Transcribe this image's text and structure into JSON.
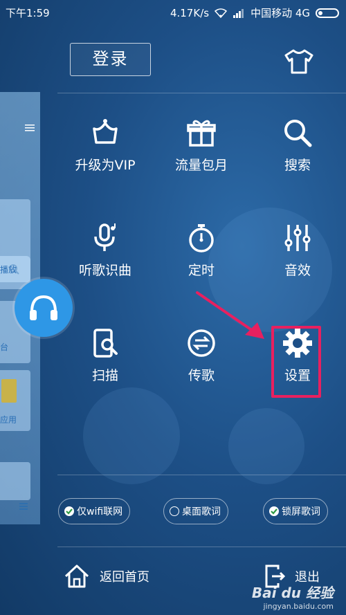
{
  "status_bar": {
    "time": "下午1:59",
    "speed": "4.17K/s",
    "carrier": "中国移动 4G"
  },
  "background_panel": {
    "items": [
      {
        "label": "播放"
      },
      {
        "label": "台"
      },
      {
        "label": "应用"
      }
    ]
  },
  "header": {
    "login_label": "登录",
    "skin_icon": "tshirt-icon"
  },
  "menu": {
    "items": [
      {
        "label": "升级为VIP",
        "icon": "crown-icon"
      },
      {
        "label": "流量包月",
        "icon": "gift-icon"
      },
      {
        "label": "搜索",
        "icon": "search-icon"
      },
      {
        "label": "听歌识曲",
        "icon": "microphone-icon"
      },
      {
        "label": "定时",
        "icon": "stopwatch-icon"
      },
      {
        "label": "音效",
        "icon": "equalizer-icon"
      },
      {
        "label": "扫描",
        "icon": "phone-scan-icon"
      },
      {
        "label": "传歌",
        "icon": "transfer-icon"
      },
      {
        "label": "设置",
        "icon": "gear-icon"
      }
    ]
  },
  "toggles": [
    {
      "label": "仅wifi联网",
      "checked": true
    },
    {
      "label": "桌面歌词",
      "checked": false
    },
    {
      "label": "锁屏歌词",
      "checked": true
    }
  ],
  "footer": {
    "home_label": "返回首页",
    "exit_label": "退出"
  },
  "watermark": {
    "brand": "Bai du 经验",
    "url": "jingyan.baidu.com"
  },
  "colors": {
    "background": "#1d4f86",
    "annotation": "#e8205f",
    "fab": "#2e97e6"
  }
}
